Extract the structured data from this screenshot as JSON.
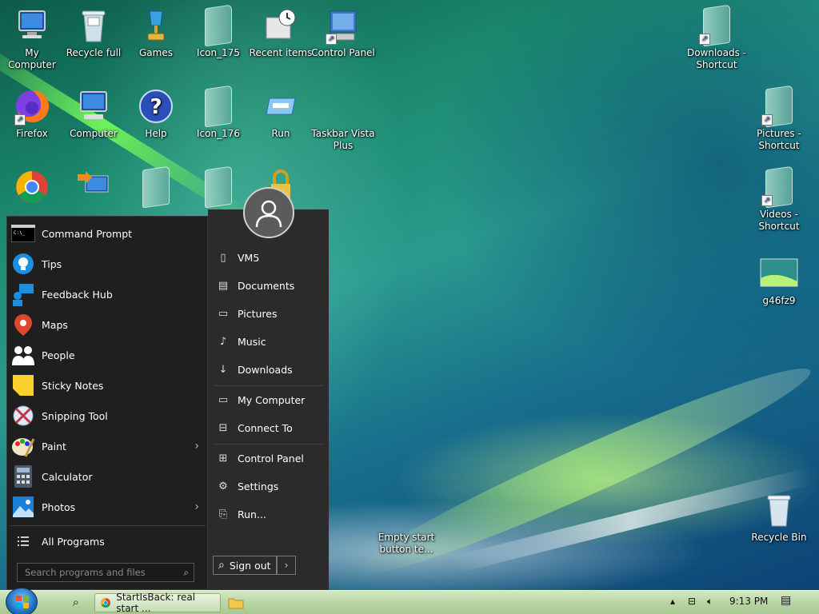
{
  "desktop": {
    "icons": [
      {
        "label": "My Computer",
        "icon": "computer-icon"
      },
      {
        "label": "Recycle full",
        "icon": "recycle-full-icon"
      },
      {
        "label": "Games",
        "icon": "games-icon"
      },
      {
        "label": "Icon_175",
        "icon": "folder-icon"
      },
      {
        "label": "Recent items",
        "icon": "recent-items-icon"
      },
      {
        "label": "Control Panel",
        "icon": "control-panel-icon"
      },
      {
        "label": "Downloads - Shortcut",
        "icon": "folder-shortcut-icon"
      },
      {
        "label": "Firefox",
        "icon": "firefox-icon"
      },
      {
        "label": "Computer",
        "icon": "computer-icon"
      },
      {
        "label": "Help",
        "icon": "help-icon"
      },
      {
        "label": "Icon_176",
        "icon": "folder-icon"
      },
      {
        "label": "Run",
        "icon": "run-icon"
      },
      {
        "label": "Taskbar Vista Plus",
        "icon": "blank-icon"
      },
      {
        "label": "Pictures - Shortcut",
        "icon": "pictures-shortcut-icon"
      },
      {
        "label": "Videos - Shortcut",
        "icon": "videos-shortcut-icon"
      },
      {
        "label": "g46fz9",
        "icon": "image-file-icon"
      },
      {
        "label": "Recycle Bin",
        "icon": "recycle-bin-icon"
      },
      {
        "label": "Empty start button te...",
        "icon": "blank-icon"
      }
    ]
  },
  "startmenu": {
    "programs": [
      {
        "label": "Command Prompt",
        "icon": "command-prompt-icon",
        "submenu": false
      },
      {
        "label": "Tips",
        "icon": "tips-icon",
        "submenu": false
      },
      {
        "label": "Feedback Hub",
        "icon": "feedback-hub-icon",
        "submenu": false
      },
      {
        "label": "Maps",
        "icon": "maps-icon",
        "submenu": false
      },
      {
        "label": "People",
        "icon": "people-icon",
        "submenu": false
      },
      {
        "label": "Sticky Notes",
        "icon": "sticky-notes-icon",
        "submenu": false
      },
      {
        "label": "Snipping Tool",
        "icon": "snipping-tool-icon",
        "submenu": false
      },
      {
        "label": "Paint",
        "icon": "paint-icon",
        "submenu": true
      },
      {
        "label": "Calculator",
        "icon": "calculator-icon",
        "submenu": false
      },
      {
        "label": "Photos",
        "icon": "photos-icon",
        "submenu": true
      }
    ],
    "all_programs": "All Programs",
    "search_placeholder": "Search programs and files",
    "right_links": [
      {
        "label": "VM5",
        "icon": "user-folder-icon"
      },
      {
        "label": "Documents",
        "icon": "documents-icon"
      },
      {
        "label": "Pictures",
        "icon": "pictures-icon"
      },
      {
        "label": "Music",
        "icon": "music-icon"
      },
      {
        "label": "Downloads",
        "icon": "downloads-icon"
      },
      {
        "label": "My Computer",
        "icon": "computer-icon"
      },
      {
        "label": "Connect To",
        "icon": "connect-to-icon"
      },
      {
        "label": "Control Panel",
        "icon": "control-panel-icon"
      },
      {
        "label": "Settings",
        "icon": "settings-gear-icon"
      },
      {
        "label": "Run...",
        "icon": "run-icon"
      }
    ],
    "sign_out": "Sign out"
  },
  "taskbar": {
    "task_title": "StartIsBack: real start ...",
    "clock": "9:13 PM"
  }
}
